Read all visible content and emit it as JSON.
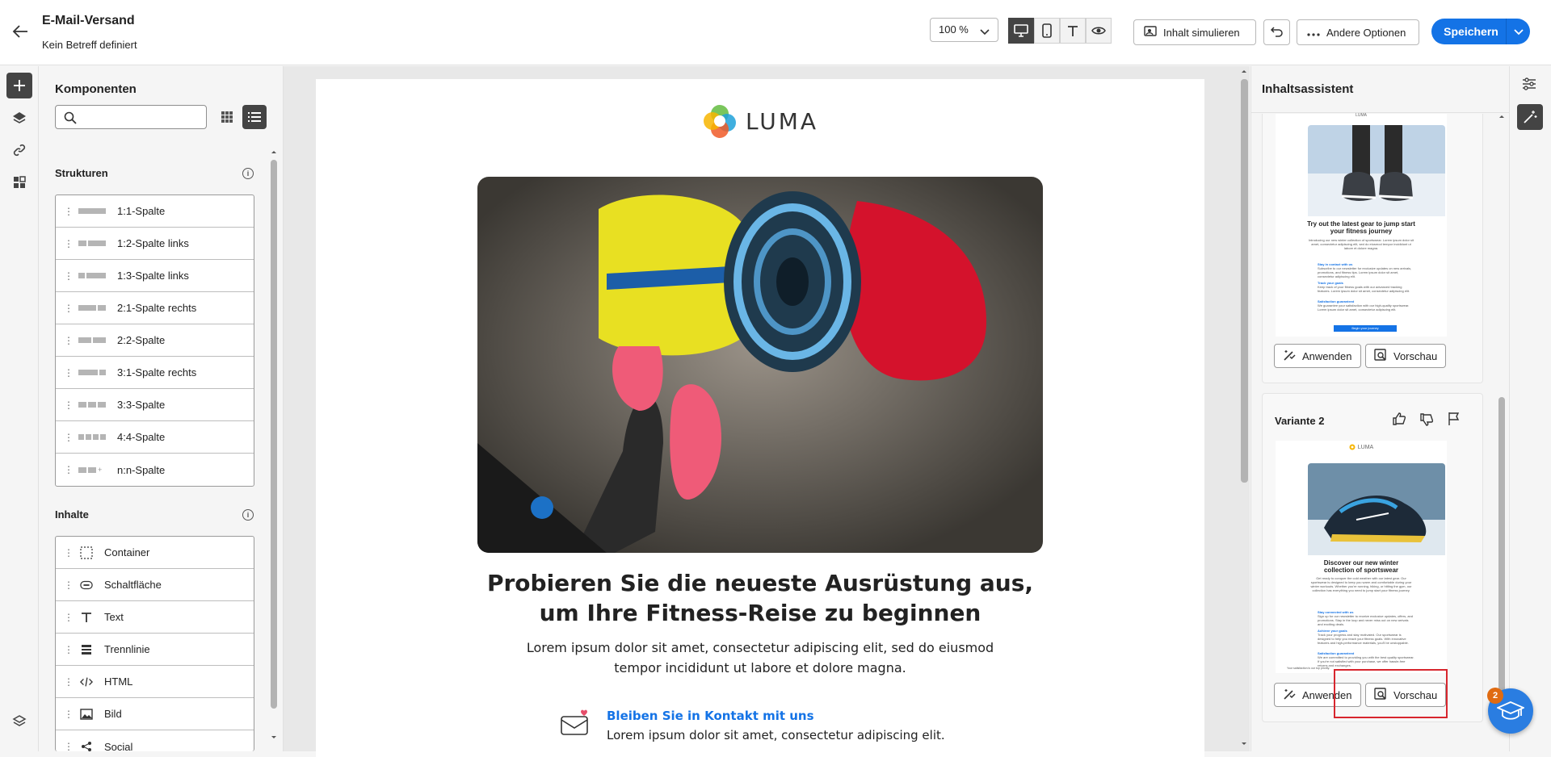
{
  "header": {
    "title": "E-Mail-Versand",
    "subtitle": "Kein Betreff definiert",
    "zoom": "100 %",
    "simulate_label": "Inhalt simulieren",
    "more_options_label": "Andere Optionen",
    "save_label": "Speichern"
  },
  "left_panel": {
    "title": "Komponenten",
    "search_placeholder": "",
    "structures_title": "Strukturen",
    "structures": [
      {
        "label": "1:1-Spalte"
      },
      {
        "label": "1:2-Spalte links"
      },
      {
        "label": "1:3-Spalte links"
      },
      {
        "label": "2:1-Spalte rechts"
      },
      {
        "label": "2:2-Spalte"
      },
      {
        "label": "3:1-Spalte rechts"
      },
      {
        "label": "3:3-Spalte"
      },
      {
        "label": "4:4-Spalte"
      },
      {
        "label": "n:n-Spalte"
      }
    ],
    "contents_title": "Inhalte",
    "contents": [
      {
        "label": "Container",
        "icon": "container-icon"
      },
      {
        "label": "Schaltfläche",
        "icon": "button-icon"
      },
      {
        "label": "Text",
        "icon": "text-icon"
      },
      {
        "label": "Trennlinie",
        "icon": "divider-icon"
      },
      {
        "label": "HTML",
        "icon": "code-icon"
      },
      {
        "label": "Bild",
        "icon": "image-icon"
      },
      {
        "label": "Social",
        "icon": "social-icon"
      }
    ]
  },
  "email": {
    "logo_text": "LUMA",
    "headline": "Probieren Sie die neueste Ausrüstung aus, um Ihre Fitness-Reise zu beginnen",
    "body": "Lorem ipsum dolor sit amet, consectetur adipiscing elit, sed do eiusmod tempor incididunt ut labore et dolore magna.",
    "feature_title": "Bleiben Sie in Kontakt mit uns",
    "feature_text": "Lorem ipsum dolor sit amet, consectetur adipiscing elit."
  },
  "right_panel": {
    "title": "Inhaltsassistent",
    "variant1": {
      "thumb_logo": "LUMA",
      "thumb_headline": "Try out the latest gear to jump start your fitness journey",
      "thumb_body": "Introducing our new winter collection of sportswear. Lorem ipsum dolor sit amet, consectetur adipiscing elit, sed do eiusmod tempor incididunt ut labore et dolore magna.",
      "f1_title": "Stay in contact with us",
      "f1_text": "Subscribe to our newsletter for exclusive updates on new arrivals, promotions, and fitness tips. Lorem ipsum dolor sit amet, consectetur adipiscing elit.",
      "f2_title": "Track your goals",
      "f2_text": "Keep track of your fitness goals with our advanced tracking features. Lorem ipsum dolor sit amet, consectetur adipiscing elit.",
      "f3_title": "Satisfaction guaranteed",
      "f3_text": "We guarantee your satisfaction with our high-quality sportswear. Lorem ipsum dolor sit amet, consectetur adipiscing elit.",
      "cta": "Begin your journey",
      "apply_label": "Anwenden",
      "preview_label": "Vorschau"
    },
    "variant2": {
      "title": "Variante 2",
      "thumb_logo": "LUMA",
      "thumb_headline": "Discover our new winter collection of sportswear",
      "thumb_body": "Get ready to conquer the cold weather with our latest gear. Our sportswear is designed to keep you warm and comfortable during your winter workouts. Whether you're running, hiking, or hitting the gym, our collection has everything you need to jump start your fitness journey.",
      "f1_title": "Stay connected with us",
      "f1_text": "Sign up for our newsletter to receive exclusive updates, offers, and promotions. Stay in the loop and never miss out on new arrivals and exciting deals.",
      "f2_title": "Achieve your goals",
      "f2_text": "Track your progress and stay motivated. Our sportswear is designed to help you reach your fitness goals. With innovative features and high-performance materials, you'll be unstoppable.",
      "f3_title": "Satisfaction guaranteed",
      "f3_text": "We are committed to providing you with the best quality sportswear. If you're not satisfied with your purchase, we offer hassle-free returns and exchanges.",
      "footer_note": "Your satisfaction is our top priority.",
      "apply_label": "Anwenden",
      "preview_label": "Vorschau"
    }
  },
  "help": {
    "count": "2"
  },
  "colors": {
    "accent": "#1473e6",
    "highlight": "#d7262e",
    "badge": "#e06b12"
  }
}
